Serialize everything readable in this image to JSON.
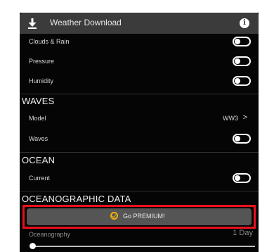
{
  "header": {
    "title": "Weather Download",
    "download_icon": "download-icon",
    "info_icon": "info-icon",
    "info_glyph": "i"
  },
  "settings": {
    "weather_rows": [
      {
        "label": "Clouds & Rain",
        "toggle": "off"
      },
      {
        "label": "Pressure",
        "toggle": "off"
      },
      {
        "label": "Humidity",
        "toggle": "off"
      }
    ],
    "waves": {
      "title": "WAVES",
      "model": {
        "label": "Model",
        "value": "WW3",
        "chevron": ">"
      },
      "waves_row": {
        "label": "Waves",
        "toggle": "off"
      }
    },
    "ocean": {
      "title": "OCEAN",
      "current_row": {
        "label": "Current",
        "toggle": "off"
      }
    },
    "oceanographic": {
      "title": "OCEANOGRAPHIC DATA",
      "premium_button": {
        "label": "Go PREMIUM!",
        "icon": "check-circle-icon"
      },
      "oceanography": {
        "label": "Oceanography",
        "value": "1 Day"
      }
    }
  },
  "colors": {
    "background": "#050505",
    "header": "#3b3b3b",
    "premium_button": "#555555",
    "highlight_outline": "#e8101c",
    "premium_icon": "#f2b10c"
  }
}
